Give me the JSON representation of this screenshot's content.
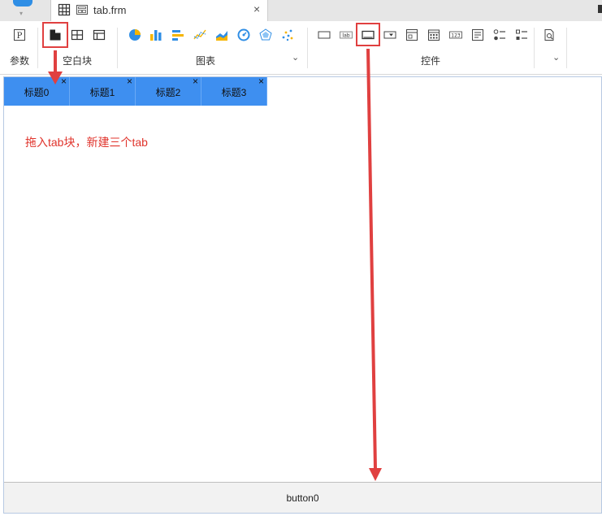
{
  "tabstrip": {
    "doc_tab_title": "tab.frm",
    "doc_tab_close": "×"
  },
  "toolbar": {
    "groups": {
      "params": "参数",
      "blank_block": "空白块",
      "charts": "图表",
      "controls": "控件"
    },
    "param_icon_text": "P",
    "chevron": "⌄",
    "label_icon_text": "lab",
    "number_icon_text": "123"
  },
  "canvas": {
    "tabs": [
      {
        "label": "标题0",
        "close": "×"
      },
      {
        "label": "标题1",
        "close": "×"
      },
      {
        "label": "标题2",
        "close": "×"
      },
      {
        "label": "标题3",
        "close": "×"
      }
    ],
    "annotation": "拖入tab块，新建三个tab",
    "bottom_button": "button0"
  },
  "colors": {
    "accent": "#3e8ff0",
    "arrow": "#e04040",
    "annotation": "#e0342c"
  }
}
